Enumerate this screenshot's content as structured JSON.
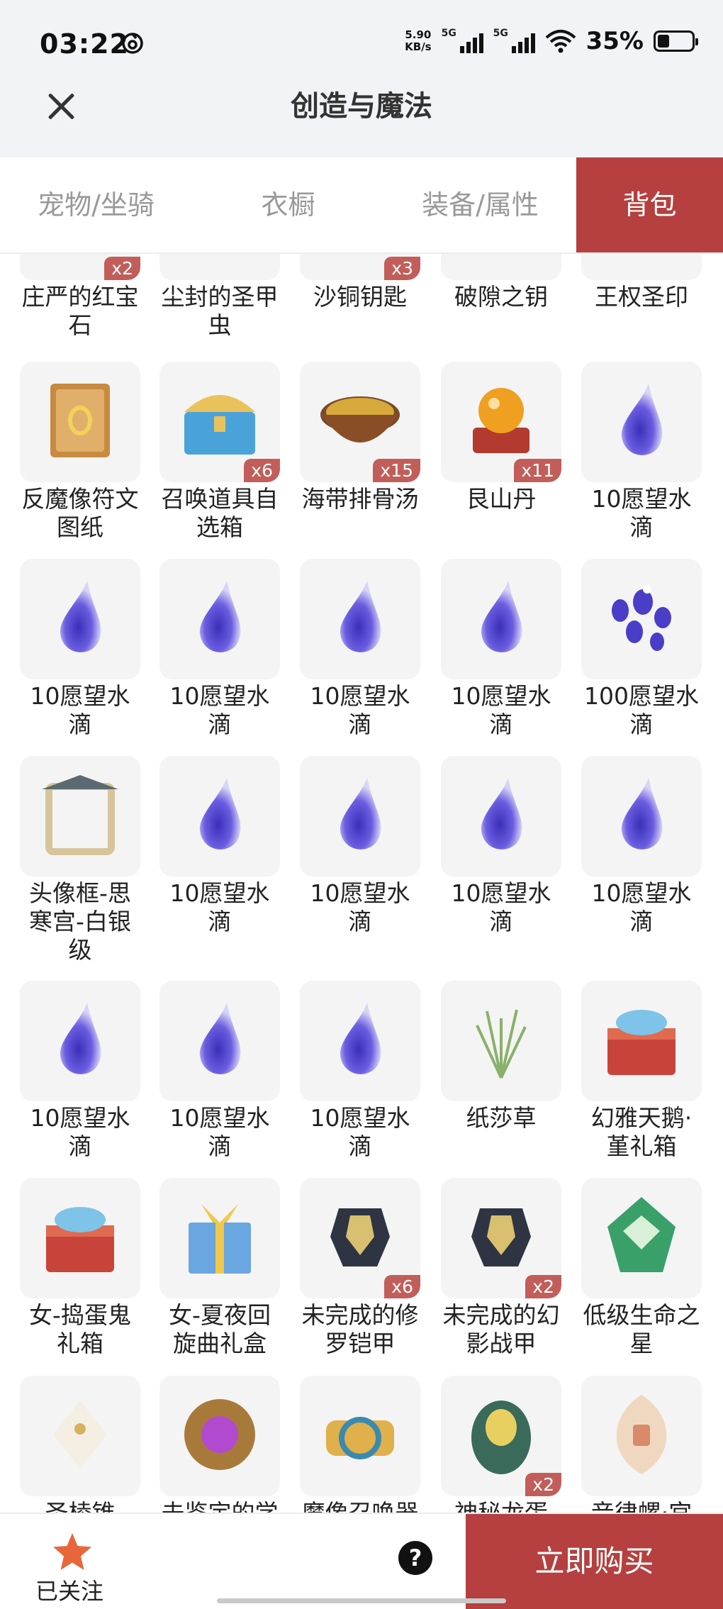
{
  "status": {
    "time": "03:22",
    "net_speed_top": "5.90",
    "net_speed_bottom": "KB/s",
    "signal1_label": "5G",
    "signal2_label": "5G",
    "battery_pct": "35%"
  },
  "header": {
    "title": "创造与魔法",
    "close_icon": "close-icon"
  },
  "tabs": [
    {
      "label": "宠物/坐骑",
      "active": false
    },
    {
      "label": "衣橱",
      "active": false
    },
    {
      "label": "装备/属性",
      "active": false
    },
    {
      "label": "背包",
      "active": true
    }
  ],
  "items": [
    {
      "name": "庄严的红宝石",
      "qty": "x2",
      "icon": "gem"
    },
    {
      "name": "尘封的圣甲虫",
      "qty": "",
      "icon": "beetle"
    },
    {
      "name": "沙铜钥匙",
      "qty": "x3",
      "icon": "key"
    },
    {
      "name": "破隙之钥",
      "qty": "",
      "icon": "key"
    },
    {
      "name": "王权圣印",
      "qty": "",
      "icon": "seal"
    },
    {
      "name": "反魔像符文图纸",
      "qty": "",
      "icon": "scroll"
    },
    {
      "name": "召唤道具自选箱",
      "qty": "x6",
      "icon": "chest"
    },
    {
      "name": "海带排骨汤",
      "qty": "x15",
      "icon": "soup"
    },
    {
      "name": "艮山丹",
      "qty": "x11",
      "icon": "orb"
    },
    {
      "name": "10愿望水滴",
      "qty": "",
      "icon": "drop"
    },
    {
      "name": "10愿望水滴",
      "qty": "",
      "icon": "drop"
    },
    {
      "name": "10愿望水滴",
      "qty": "",
      "icon": "drop"
    },
    {
      "name": "10愿望水滴",
      "qty": "",
      "icon": "drop"
    },
    {
      "name": "10愿望水滴",
      "qty": "",
      "icon": "drop"
    },
    {
      "name": "100愿望水滴",
      "qty": "",
      "icon": "drops"
    },
    {
      "name": "头像框-思寒宫-白银级",
      "qty": "",
      "icon": "frame"
    },
    {
      "name": "10愿望水滴",
      "qty": "",
      "icon": "drop"
    },
    {
      "name": "10愿望水滴",
      "qty": "",
      "icon": "drop"
    },
    {
      "name": "10愿望水滴",
      "qty": "",
      "icon": "drop"
    },
    {
      "name": "10愿望水滴",
      "qty": "",
      "icon": "drop"
    },
    {
      "name": "10愿望水滴",
      "qty": "",
      "icon": "drop"
    },
    {
      "name": "10愿望水滴",
      "qty": "",
      "icon": "drop"
    },
    {
      "name": "10愿望水滴",
      "qty": "",
      "icon": "drop"
    },
    {
      "name": "纸莎草",
      "qty": "",
      "icon": "grass"
    },
    {
      "name": "幻雅天鹅·堇礼箱",
      "qty": "",
      "icon": "giftbox"
    },
    {
      "name": "女-捣蛋鬼礼箱",
      "qty": "",
      "icon": "giftbox"
    },
    {
      "name": "女-夏夜回旋曲礼盒",
      "qty": "",
      "icon": "present"
    },
    {
      "name": "未完成的修罗铠甲",
      "qty": "x6",
      "icon": "armor"
    },
    {
      "name": "未完成的幻影战甲",
      "qty": "x2",
      "icon": "armor"
    },
    {
      "name": "低级生命之星",
      "qty": "",
      "icon": "crystal"
    },
    {
      "name": "圣棱锥",
      "qty": "",
      "icon": "pyramid"
    },
    {
      "name": "未鉴定的学",
      "qty": "",
      "icon": "relic"
    },
    {
      "name": "魔像召唤器",
      "qty": "",
      "icon": "device"
    },
    {
      "name": "神秘龙蛋",
      "qty": "x2",
      "icon": "egg"
    },
    {
      "name": "音律螺·宫",
      "qty": "",
      "icon": "shell"
    }
  ],
  "bottom": {
    "follow_label": "已关注",
    "help": "?",
    "buy_label": "立即购买"
  }
}
